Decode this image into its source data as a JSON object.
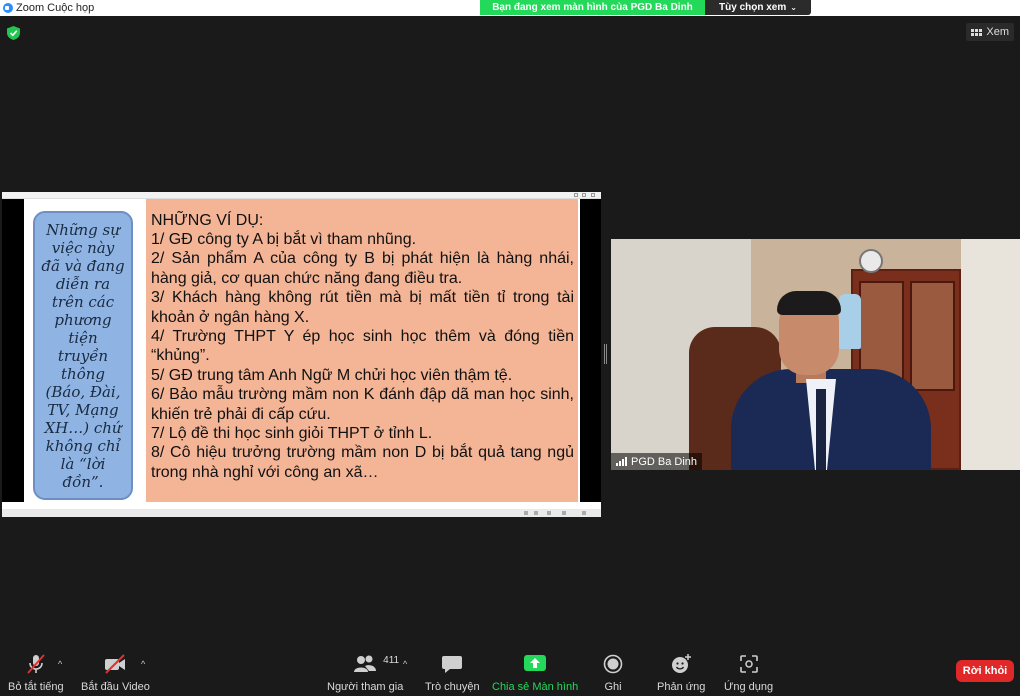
{
  "window": {
    "title": "Zoom Cuộc họp"
  },
  "share_banner": {
    "text": "Bạn đang xem màn hình của PGD Ba Dinh",
    "options_label": "Tùy chọn xem"
  },
  "view_button": {
    "label": "Xem"
  },
  "slide": {
    "bubble_text": "Những sự việc này đã và đang diễn ra trên các phương tiện truyền thông (Báo, Đài, TV, Mạng XH…) chứ không chỉ là “lời đồn”.",
    "heading": "NHỮNG VÍ DỤ:",
    "items": [
      "1/ GĐ công ty A bị bắt vì tham nhũng.",
      "2/ Sản phẩm A của công ty B bị phát hiện là hàng nhái, hàng giả, cơ quan chức năng đang điều tra.",
      "3/ Khách hàng không rút tiền mà bị mất tiền tỉ trong tài khoản ở ngân hàng X.",
      "4/ Trường THPT Y ép học sinh học thêm và đóng tiền “khủng”.",
      "5/ GĐ trung tâm Anh Ngữ M chửi học viên thậm tệ.",
      "6/ Bảo mẫu trường mầm non K đánh đập dã man học sinh, khiến trẻ phải đi cấp cứu.",
      "7/ Lộ đề thi học sinh giỏi THPT ở tỉnh L.",
      "8/ Cô hiệu trưởng trường mầm non D bị bắt quả tang ngủ trong nhà nghỉ với công an xã…"
    ]
  },
  "video": {
    "participant_name": "PGD Ba Dinh"
  },
  "toolbar": {
    "mute_label": "Bỏ tắt tiếng",
    "video_label": "Bắt đầu Video",
    "participants_label": "Người tham gia",
    "participants_count": "411",
    "chat_label": "Trò chuyện",
    "share_label": "Chia sẻ Màn hình",
    "record_label": "Ghi",
    "reactions_label": "Phản ứng",
    "apps_label": "Ứng dụng",
    "leave_label": "Rời khỏi"
  },
  "colors": {
    "share_green": "#23d959",
    "leave_red": "#e02828",
    "slide_orange": "#f4b496",
    "bubble_blue": "#8fb4e3",
    "mute_red": "#e03030"
  }
}
